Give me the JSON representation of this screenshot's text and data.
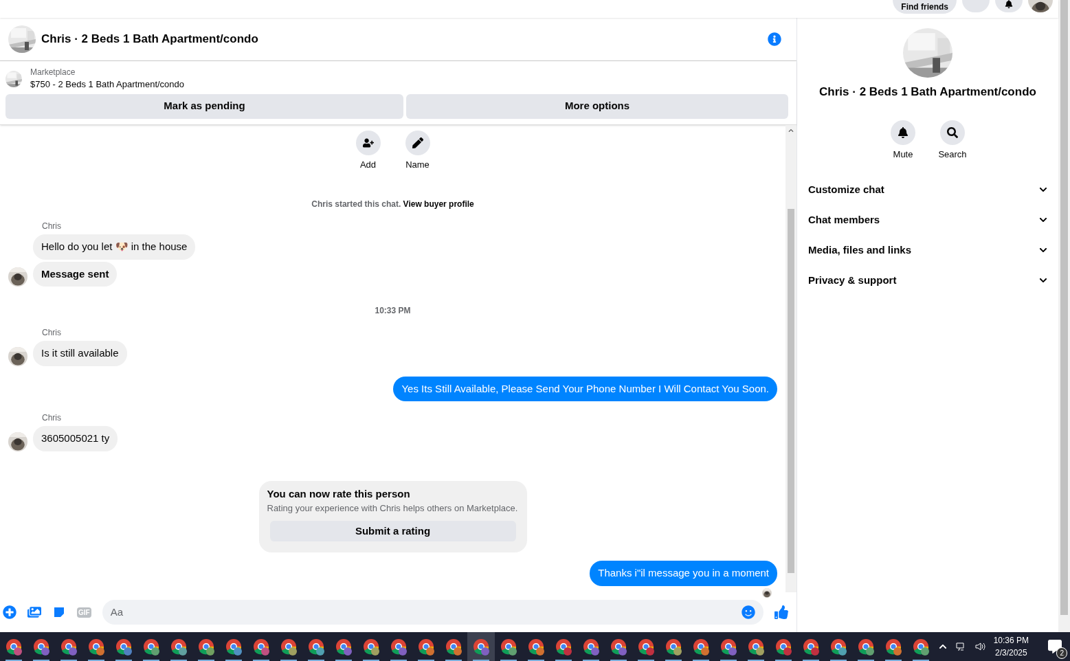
{
  "top_bar": {
    "find_friends": "Find friends"
  },
  "chat_header": {
    "title": "Chris · 2 Beds 1 Bath Apartment/condo"
  },
  "listing": {
    "source": "Marketplace",
    "title": "$750 - 2 Beds 1 Bath Apartment/condo",
    "buttons": [
      "Mark as pending",
      "More options"
    ]
  },
  "actions": [
    {
      "kind": "add",
      "label": "Add"
    },
    {
      "kind": "name",
      "label": "Name"
    }
  ],
  "messages": [
    {
      "kind": "system",
      "text": "Chris started this chat.",
      "link": "View buyer profile"
    },
    {
      "kind": "incoming",
      "sender": "Chris",
      "bubbles": [
        {
          "text": "Hello do you let 🐶 in the house",
          "bold": false
        },
        {
          "text": "Message sent",
          "bold": true
        }
      ]
    },
    {
      "kind": "timestamp",
      "text": "10:33 PM"
    },
    {
      "kind": "incoming",
      "sender": "Chris",
      "bubbles": [
        {
          "text": "Is it still available",
          "bold": false
        }
      ]
    },
    {
      "kind": "outgoing",
      "text": "Yes Its Still Available, Please Send Your Phone Number I Will Contact You Soon."
    },
    {
      "kind": "incoming",
      "sender": "Chris",
      "bubbles": [
        {
          "text": "3605005021 ty",
          "bold": false
        }
      ]
    },
    {
      "kind": "rating",
      "title": "You can now rate this person",
      "text": "Rating your experience with Chris helps others on Marketplace.",
      "button": "Submit a rating"
    },
    {
      "kind": "outgoing",
      "text": "Thanks i\"il message you in a moment"
    },
    {
      "kind": "seen_receipt"
    }
  ],
  "composer": {
    "placeholder": "Aa",
    "gif": "GIF"
  },
  "side_panel": {
    "title": "Chris · 2 Beds 1 Bath Apartment/condo",
    "actions": [
      {
        "kind": "mute",
        "label": "Mute"
      },
      {
        "kind": "search",
        "label": "Search"
      }
    ],
    "sections": [
      {
        "label": "Customize chat",
        "expanded": false
      },
      {
        "label": "Chat members",
        "expanded": false
      },
      {
        "label": "Media, files and links",
        "expanded": false
      },
      {
        "label": "Privacy & support",
        "expanded": false
      }
    ]
  },
  "taskbar": {
    "apps": [
      {
        "color": "#c05080",
        "selected": false
      },
      {
        "color": "#8060c0",
        "selected": false
      },
      {
        "color": "#8060c0",
        "selected": false
      },
      {
        "color": "#d07030",
        "selected": false
      },
      {
        "color": "#5080c0",
        "selected": false
      },
      {
        "color": "#60a070",
        "selected": false
      },
      {
        "color": "#60a0a0",
        "selected": false
      },
      {
        "color": "#70a060",
        "selected": false
      },
      {
        "color": "#5090c0",
        "selected": false
      },
      {
        "color": "#c05080",
        "selected": false
      },
      {
        "color": "#a0a060",
        "selected": false
      },
      {
        "color": "#50a0b0",
        "selected": false
      },
      {
        "color": "#8060c0",
        "selected": false
      },
      {
        "color": "#a0a060",
        "selected": false
      },
      {
        "color": "#8060c0",
        "selected": false
      },
      {
        "color": "#d07030",
        "selected": false
      },
      {
        "color": "#d07030",
        "selected": false
      },
      {
        "color": "#8060c0",
        "selected": true
      },
      {
        "color": "#60a070",
        "selected": false
      },
      {
        "color": "#d07030",
        "selected": false
      },
      {
        "color": "#c03040",
        "selected": false
      },
      {
        "color": "#8060c0",
        "selected": false
      },
      {
        "color": "#8060c0",
        "selected": false
      },
      {
        "color": "#c03040",
        "selected": false
      },
      {
        "color": "#a0a060",
        "selected": false
      },
      {
        "color": "#d07030",
        "selected": false
      },
      {
        "color": "#8060c0",
        "selected": false
      },
      {
        "color": "#a0a060",
        "selected": false
      },
      {
        "color": "#c03040",
        "selected": false
      },
      {
        "color": "#c03040",
        "selected": false
      },
      {
        "color": "#50a0b0",
        "selected": false
      },
      {
        "color": "#60a070",
        "selected": false
      },
      {
        "color": "#d07030",
        "selected": false
      },
      {
        "color": "#60a070",
        "selected": false
      }
    ],
    "time": "10:36 PM",
    "date": "2/3/2025",
    "notifications": "2"
  }
}
